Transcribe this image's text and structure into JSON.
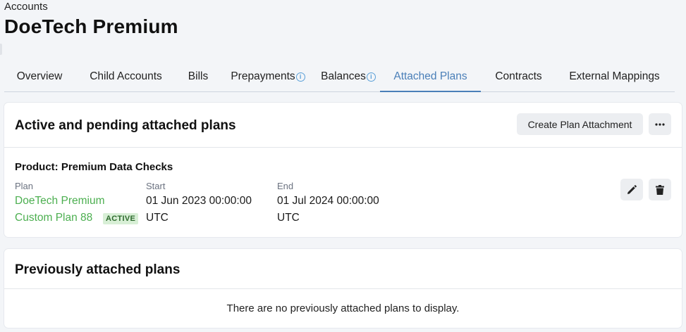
{
  "header": {
    "breadcrumb": "Accounts",
    "title": "DoeTech Premium"
  },
  "tabs": [
    {
      "label": "Overview"
    },
    {
      "label": "Child Accounts"
    },
    {
      "label": "Bills"
    },
    {
      "label": "Prepayments"
    },
    {
      "label": "Balances"
    },
    {
      "label": "Attached Plans"
    },
    {
      "label": "Contracts"
    },
    {
      "label": "External Mappings"
    }
  ],
  "active_section": {
    "title": "Active and pending attached plans",
    "create_button": "Create Plan Attachment",
    "more_icon": "more-horizontal-icon",
    "product": "Product: Premium Data Checks",
    "columns": {
      "plan": "Plan",
      "start": "Start",
      "end": "End"
    },
    "row": {
      "plan_name_line1": "DoeTech Premium",
      "plan_name_line2": "Custom Plan 88",
      "status": "ACTIVE",
      "start_line1": "01 Jun 2023 00:00:00",
      "start_line2": "UTC",
      "end_line1": "01 Jul 2024 00:00:00",
      "end_line2": "UTC"
    },
    "edit_icon": "pencil-icon",
    "delete_icon": "trash-icon"
  },
  "previous_section": {
    "title": "Previously attached plans",
    "empty_message": "There are no previously attached plans to display."
  },
  "colors": {
    "accent": "#4a7fb8",
    "link_green": "#4caf50",
    "badge_bg": "#d8efd6"
  }
}
